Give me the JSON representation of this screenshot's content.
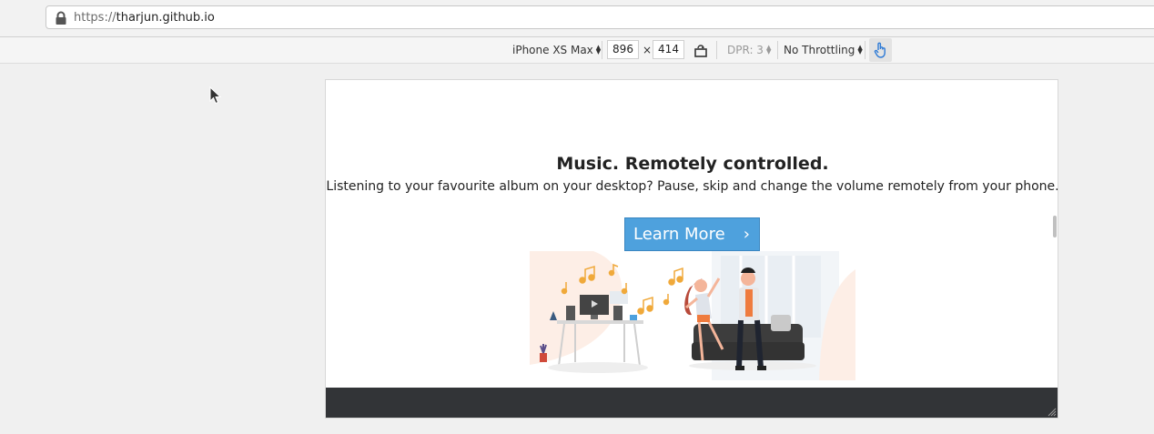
{
  "browser": {
    "url_scheme": "https://",
    "url_host": "tharjun.github.io"
  },
  "device_toolbar": {
    "device": "iPhone XS Max",
    "width": "896",
    "times": "×",
    "height": "414",
    "dpr": "DPR: 3",
    "throttling": "No Throttling"
  },
  "page": {
    "headline": "Music. Remotely controlled.",
    "subline": "Listening to your favourite album on your desktop? Pause, skip and change the volume remotely from your phone.",
    "cta_label": "Learn More",
    "cta_chevron": "›"
  },
  "colors": {
    "cta": "#4ea1dd",
    "footer": "#323437",
    "accent_orange": "#f0a93a"
  }
}
